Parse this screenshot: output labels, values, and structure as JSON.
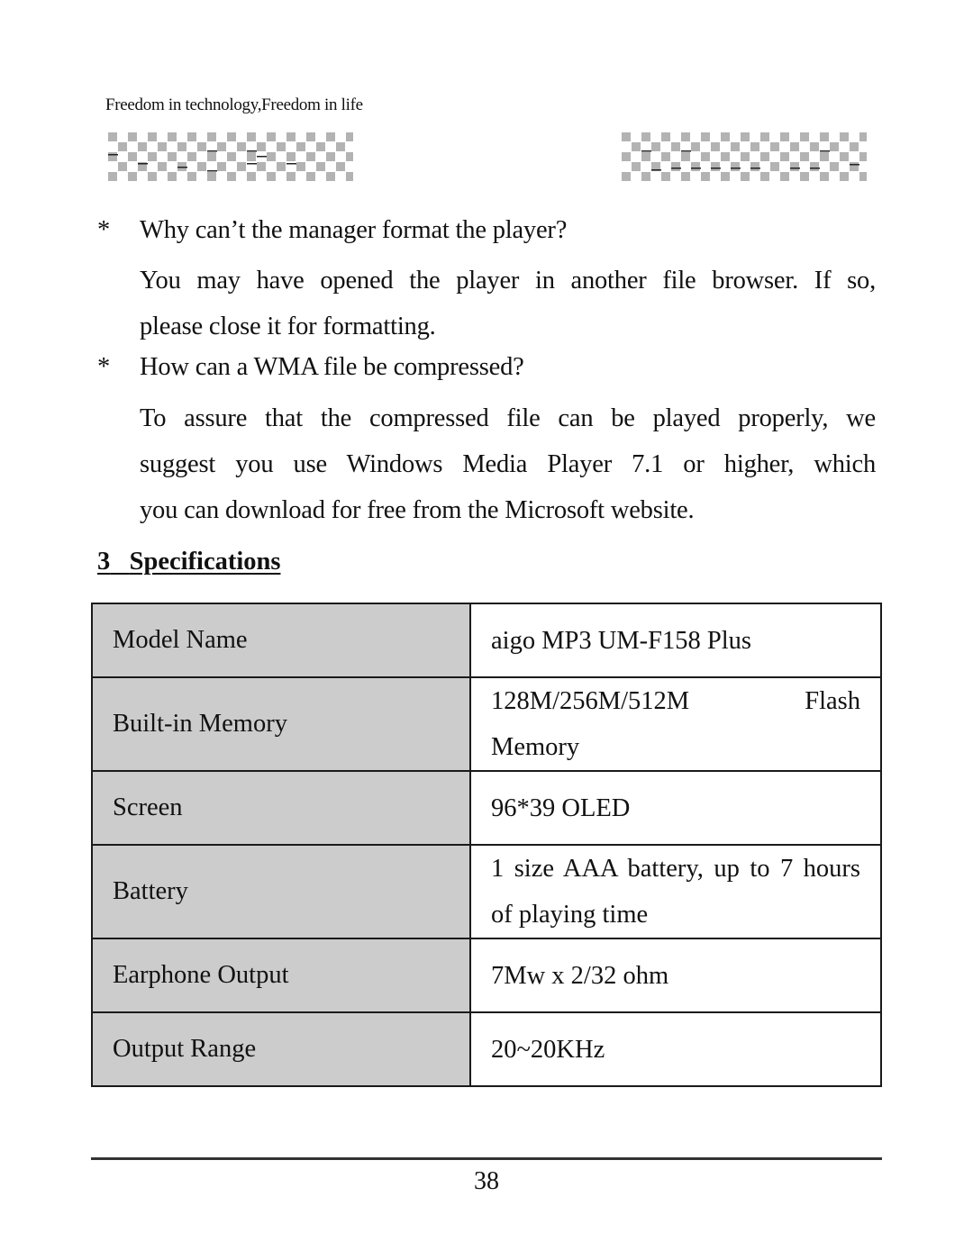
{
  "header": {
    "tagline": "Freedom in technology,Freedom in life",
    "left_decoration": "checker-banner-icon",
    "right_decoration": "checker-banner-icon",
    "checker_color": "#b3b3b3"
  },
  "faq": [
    {
      "bullet": "*",
      "question": "Why can’t the manager format the player?",
      "answer_lines": [
        "You may have opened the player in another file browser. If so,",
        "please close it for formatting."
      ]
    },
    {
      "bullet": "*",
      "question": "How can a WMA file be compressed?",
      "answer_lines": [
        "To assure that the compressed file can be played properly, we",
        "suggest you use Windows Media Player 7.1 or higher, which",
        "you can download for free from the Microsoft website."
      ]
    }
  ],
  "section": {
    "number": "3",
    "title": "Specifications"
  },
  "spec_table": {
    "label_bg": "#cccccc",
    "rows": [
      {
        "label": "Model Name",
        "value_lines": [
          "aigo MP3 UM-F158 Plus"
        ]
      },
      {
        "label": "Built-in Memory",
        "value_lines": [
          "128M/256M/512M Flash",
          "Memory"
        ]
      },
      {
        "label": "Screen",
        "value_lines": [
          "96*39 OLED"
        ]
      },
      {
        "label": "Battery",
        "value_lines": [
          "1 size AAA battery, up to 7 hours",
          "of playing time"
        ]
      },
      {
        "label": "Earphone Output",
        "value_lines": [
          "7Mw x 2/32 ohm"
        ]
      },
      {
        "label": "Output Range",
        "value_lines": [
          "20~20KHz"
        ]
      }
    ]
  },
  "footer": {
    "page_number": "38"
  }
}
